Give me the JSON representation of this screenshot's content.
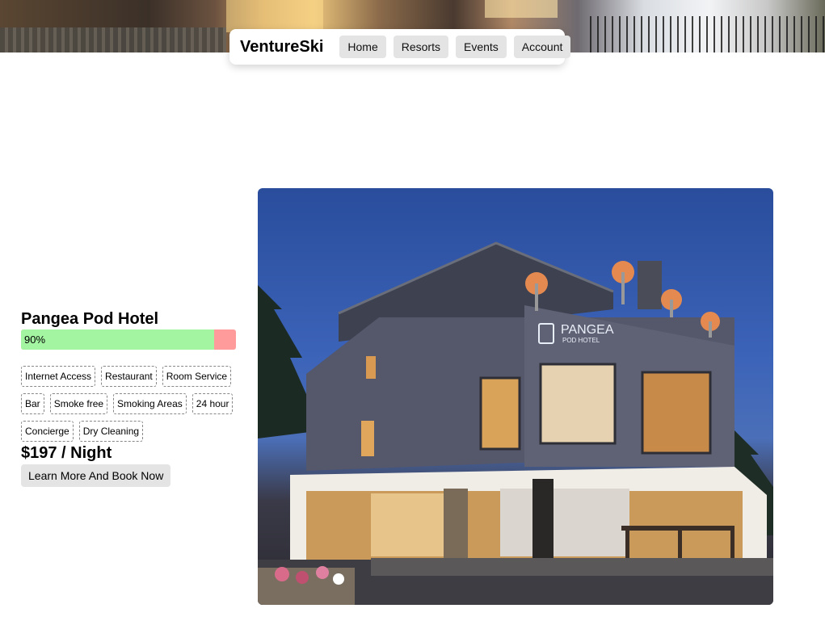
{
  "nav": {
    "brand": "VentureSki",
    "links": [
      "Home",
      "Resorts",
      "Events",
      "Account"
    ]
  },
  "hotel": {
    "name": "Pangea Pod Hotel",
    "rating_label": "90%",
    "rating_value": 0.9,
    "amenities": [
      "Internet Access",
      "Restaurant",
      "Room Service",
      "Bar",
      "Smoke free",
      "Smoking Areas",
      "24 hour",
      "Concierge",
      "Dry Cleaning"
    ],
    "price": "$197 / Night",
    "cta": "Learn More And Book Now",
    "sign_line1": "PANGEA",
    "sign_line2": "POD HOTEL"
  },
  "colors": {
    "rating_fill": "#a3f5a1",
    "rating_remainder": "#ff9b9b",
    "button_bg": "#e4e4e4"
  }
}
